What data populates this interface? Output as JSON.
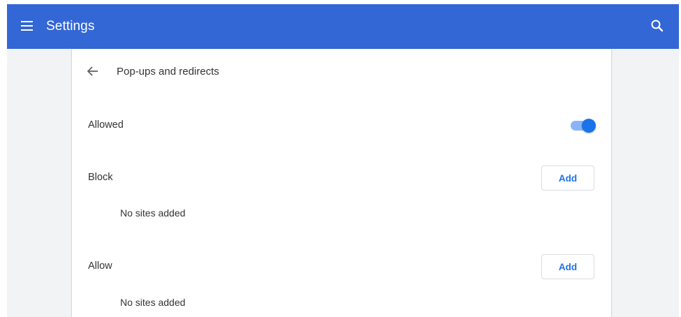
{
  "toolbar": {
    "title": "Settings",
    "menu_icon": "hamburger-menu-icon",
    "search_icon": "search-icon",
    "color": "#3367d6"
  },
  "subpage": {
    "title": "Pop-ups and redirects",
    "back_icon": "back-arrow-icon"
  },
  "default_setting": {
    "label": "Allowed",
    "enabled": true,
    "accent": "#1a73e8"
  },
  "block_list": {
    "label": "Block",
    "add_label": "Add",
    "empty_text": "No sites added"
  },
  "allow_list": {
    "label": "Allow",
    "add_label": "Add",
    "empty_text": "No sites added"
  }
}
